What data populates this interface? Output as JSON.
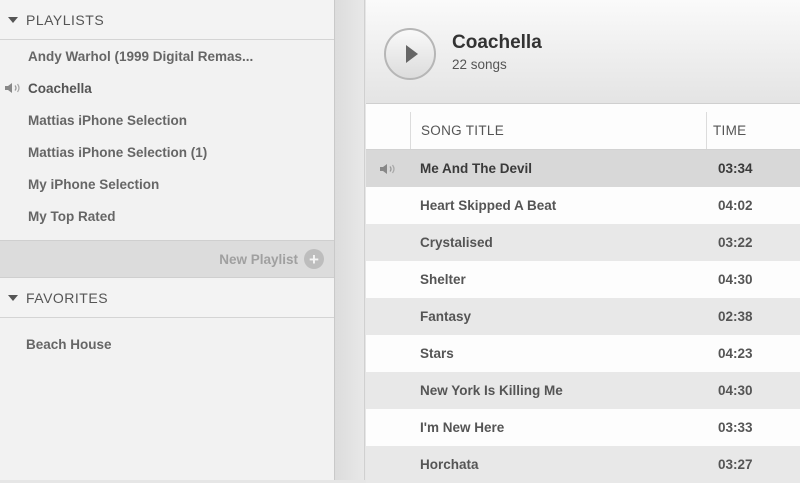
{
  "sidebar": {
    "playlists_header": "PLAYLISTS",
    "playlists": [
      {
        "label": "Andy Warhol (1999 Digital Remas...",
        "playing": false
      },
      {
        "label": "Coachella",
        "playing": true
      },
      {
        "label": "Mattias iPhone Selection",
        "playing": false
      },
      {
        "label": "Mattias iPhone Selection (1)",
        "playing": false
      },
      {
        "label": "My iPhone Selection",
        "playing": false
      },
      {
        "label": "My Top Rated",
        "playing": false
      }
    ],
    "new_playlist_label": "New Playlist",
    "favorites_header": "FAVORITES",
    "favorites": [
      {
        "label": "Beach House"
      }
    ]
  },
  "main": {
    "playlist_title": "Coachella",
    "song_count": "22 songs",
    "columns": {
      "title": "SONG TITLE",
      "time": "TIME"
    },
    "songs": [
      {
        "title": "Me And The Devil",
        "time": "03:34",
        "playing": true
      },
      {
        "title": "Heart Skipped A Beat",
        "time": "04:02",
        "playing": false
      },
      {
        "title": "Crystalised",
        "time": "03:22",
        "playing": false
      },
      {
        "title": "Shelter",
        "time": "04:30",
        "playing": false
      },
      {
        "title": "Fantasy",
        "time": "02:38",
        "playing": false
      },
      {
        "title": "Stars",
        "time": "04:23",
        "playing": false
      },
      {
        "title": "New York Is Killing Me",
        "time": "04:30",
        "playing": false
      },
      {
        "title": "I'm New Here",
        "time": "03:33",
        "playing": false
      },
      {
        "title": "Horchata",
        "time": "03:27",
        "playing": false
      }
    ]
  },
  "icons": {
    "section_toggle": "disclosure-triangle-icon",
    "now_playing": "speaker-icon",
    "add": "plus-circle-icon",
    "play": "play-icon"
  }
}
